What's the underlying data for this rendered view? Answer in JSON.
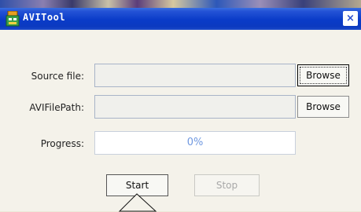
{
  "window": {
    "title": "AVITool",
    "close_symbol": "×",
    "icon_name": "app-icon"
  },
  "form": {
    "source_label": "Source file:",
    "source_value": "",
    "avi_label": "AVIFilePath:",
    "avi_value": "",
    "browse_source_label": "Browse",
    "browse_avi_label": "Browse",
    "progress_label": "Progress:",
    "progress_text": "0%",
    "progress_fraction": 0,
    "start_label": "Start",
    "stop_label": "Stop"
  },
  "colors": {
    "titlebar": "#0a3bc8",
    "dialog_background": "#f4f2ea",
    "progress_text": "#6f98e0",
    "disabled_text": "#a8a8a8"
  }
}
